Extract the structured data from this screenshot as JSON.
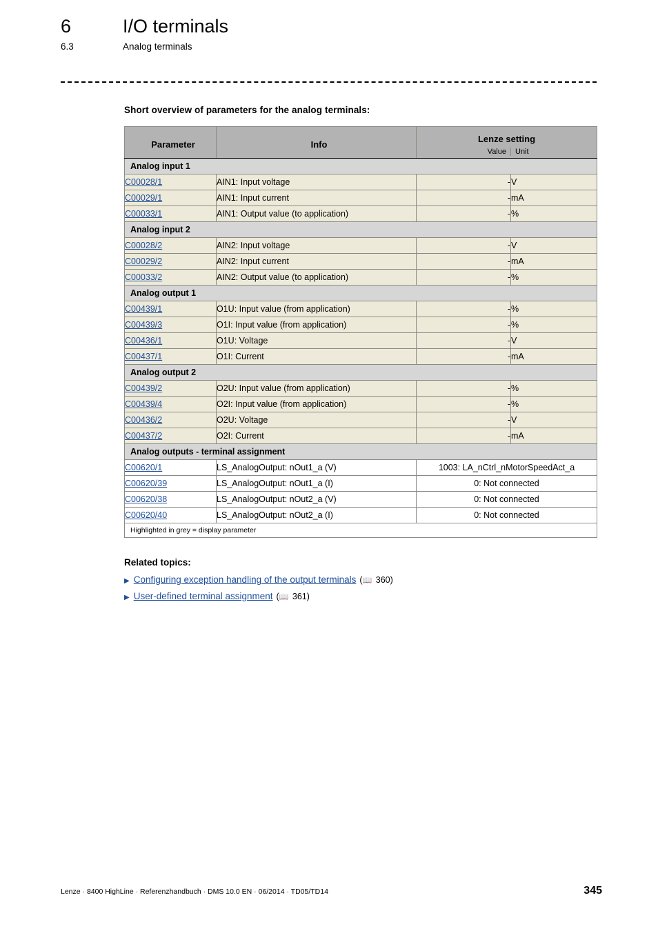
{
  "header": {
    "chapter_number": "6",
    "chapter_title": "I/O terminals",
    "section_number": "6.3",
    "section_title": "Analog terminals"
  },
  "overview_title": "Short overview of parameters for the analog terminals:",
  "table": {
    "columns": {
      "parameter": "Parameter",
      "info": "Info",
      "lenze_setting": "Lenze setting",
      "value": "Value",
      "unit": "Unit"
    },
    "groups": [
      {
        "label": "Analog input 1",
        "rows": [
          {
            "param": "C00028/1",
            "info": "AIN1: Input voltage",
            "value": "-",
            "unit": "V"
          },
          {
            "param": "C00029/1",
            "info": "AIN1: Input current",
            "value": "-",
            "unit": "mA"
          },
          {
            "param": "C00033/1",
            "info": "AIN1: Output value (to application)",
            "value": "-",
            "unit": "%"
          }
        ]
      },
      {
        "label": "Analog input 2",
        "rows": [
          {
            "param": "C00028/2",
            "info": "AIN2: Input voltage",
            "value": "-",
            "unit": "V"
          },
          {
            "param": "C00029/2",
            "info": "AIN2: Input current",
            "value": "-",
            "unit": "mA"
          },
          {
            "param": "C00033/2",
            "info": "AIN2: Output value (to application)",
            "value": "-",
            "unit": "%"
          }
        ]
      },
      {
        "label": "Analog output 1",
        "rows": [
          {
            "param": "C00439/1",
            "info": "O1U: Input value (from application)",
            "value": "-",
            "unit": "%"
          },
          {
            "param": "C00439/3",
            "info": "O1I: Input value (from application)",
            "value": "-",
            "unit": "%"
          },
          {
            "param": "C00436/1",
            "info": "O1U: Voltage",
            "value": "-",
            "unit": "V"
          },
          {
            "param": "C00437/1",
            "info": "O1I: Current",
            "value": "-",
            "unit": "mA"
          }
        ]
      },
      {
        "label": "Analog output 2",
        "rows": [
          {
            "param": "C00439/2",
            "info": "O2U: Input value (from application)",
            "value": "-",
            "unit": "%"
          },
          {
            "param": "C00439/4",
            "info": "O2I: Input value (from application)",
            "value": "-",
            "unit": "%"
          },
          {
            "param": "C00436/2",
            "info": "O2U: Voltage",
            "value": "-",
            "unit": "V"
          },
          {
            "param": "C00437/2",
            "info": "O2I: Current",
            "value": "-",
            "unit": "mA"
          }
        ]
      },
      {
        "label": "Analog outputs - terminal assignment",
        "rows": [
          {
            "param": "C00620/1",
            "info": "LS_AnalogOutput: nOut1_a (V)",
            "setting": "1003: LA_nCtrl_nMotorSpeedAct_a"
          },
          {
            "param": "C00620/39",
            "info": "LS_AnalogOutput: nOut1_a (I)",
            "setting": "0: Not connected"
          },
          {
            "param": "C00620/38",
            "info": "LS_AnalogOutput: nOut2_a (V)",
            "setting": "0: Not connected"
          },
          {
            "param": "C00620/40",
            "info": "LS_AnalogOutput: nOut2_a (I)",
            "setting": "0: Not connected"
          }
        ]
      }
    ],
    "footnote": "Highlighted in grey = display parameter"
  },
  "related": {
    "title": "Related topics:",
    "bullet": "▶",
    "book_icon": "📖",
    "items": [
      {
        "label": "Configuring exception handling of the output terminals",
        "page": "360"
      },
      {
        "label": "User-defined terminal assignment",
        "page": "361"
      }
    ]
  },
  "footer": {
    "text": "Lenze · 8400 HighLine · Referenzhandbuch · DMS 10.0 EN · 06/2014 · TD05/TD14",
    "page_number": "345"
  },
  "colors": {
    "link": "#1f4e9c",
    "table_header_bg": "#b3b3b3",
    "group_row_bg": "#d6d6d6",
    "data_row_bg": "#edeada"
  }
}
